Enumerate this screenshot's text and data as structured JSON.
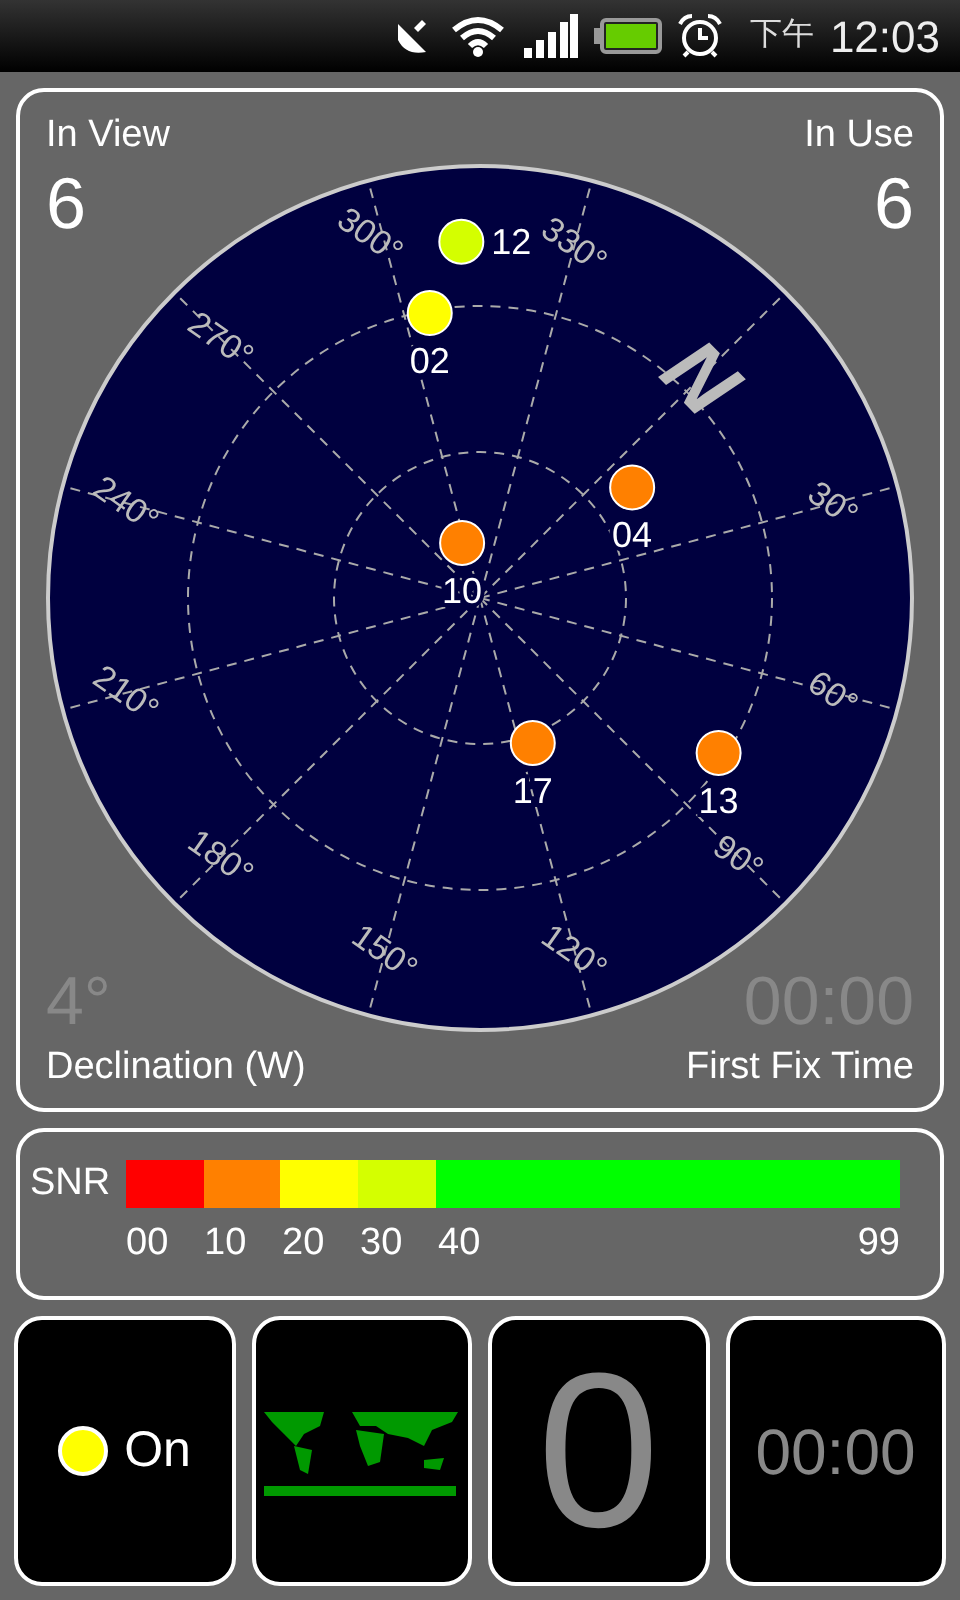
{
  "status_bar": {
    "period": "下午",
    "time": "12:03"
  },
  "sky_view": {
    "in_view_label": "In View",
    "in_view": "6",
    "in_use_label": "In Use",
    "in_use": "6",
    "north_label": "N",
    "declination": "4°",
    "declination_label": "Declination (W)",
    "first_fix": "00:00",
    "first_fix_label": "First Fix Time",
    "satellites": [
      {
        "label": "12",
        "color": "#d4ff00"
      },
      {
        "label": "02",
        "color": "#ffff00"
      },
      {
        "label": "04",
        "color": "#ff8000"
      },
      {
        "label": "10",
        "color": "#ff8000"
      },
      {
        "label": "17",
        "color": "#ff8000"
      },
      {
        "label": "13",
        "color": "#ff8000"
      }
    ],
    "azimuth_labels": [
      "30°",
      "60°",
      "90°",
      "120°",
      "150°",
      "180°",
      "210°",
      "240°",
      "270°",
      "300°",
      "330°"
    ]
  },
  "snr": {
    "label": "SNR",
    "segments": [
      {
        "color": "#ff0000"
      },
      {
        "color": "#ff8000"
      },
      {
        "color": "#ffff00"
      },
      {
        "color": "#d4ff00"
      },
      {
        "color": "#00ff00"
      }
    ],
    "scale": [
      "00",
      "10",
      "20",
      "30",
      "40",
      "99"
    ]
  },
  "tiles": {
    "gps": {
      "label": "On",
      "on": true
    },
    "fix_count": "0",
    "timer": "00:00"
  }
}
